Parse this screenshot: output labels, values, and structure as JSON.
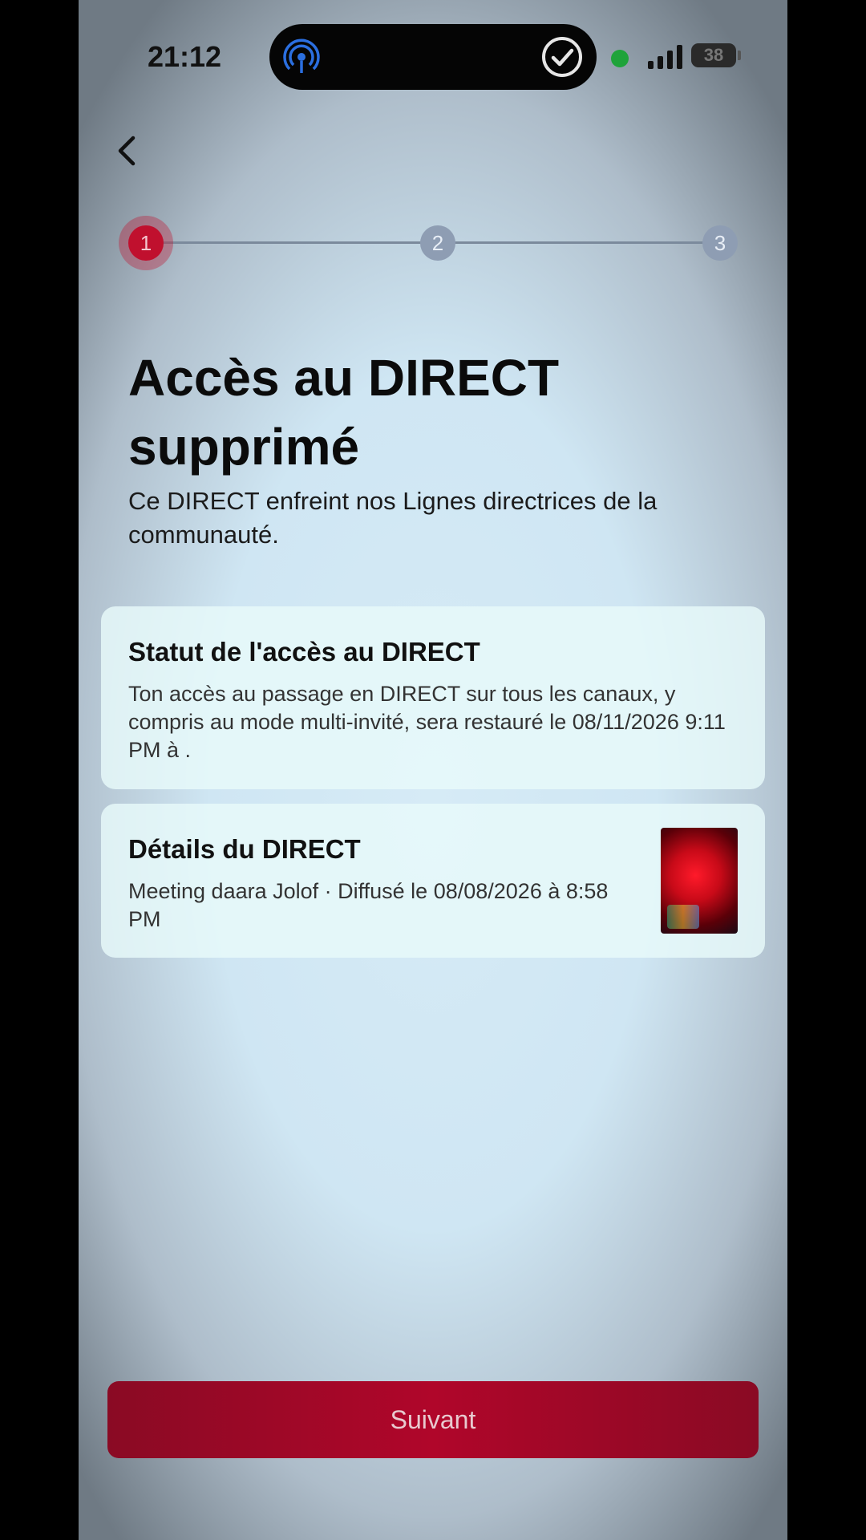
{
  "status_bar": {
    "time": "21:12",
    "battery": "38",
    "icons": [
      "airdrop-icon",
      "check-circle-icon",
      "camera-indicator-dot",
      "signal-icon",
      "battery-icon"
    ]
  },
  "nav": {
    "back_icon": "chevron-left-icon"
  },
  "stepper": {
    "steps": [
      "1",
      "2",
      "3"
    ],
    "active_step": 1,
    "active_color": "#c0102e"
  },
  "header": {
    "title": "Accès au DIRECT supprimé",
    "subtitle": "Ce DIRECT enfreint nos Lignes directrices de la communauté."
  },
  "status_card": {
    "title": "Statut de l'accès au DIRECT",
    "text": "Ton accès au passage en DIRECT sur tous les canaux, y compris au mode multi-invité, sera restauré le 08/11/2026 9:11 PM à ."
  },
  "details_card": {
    "title": "Détails du DIRECT",
    "text": "Meeting daara Jolof · Diffusé le 08/08/2026 à 8:58 PM"
  },
  "footer": {
    "next_label": "Suivant",
    "button_color": "#b0062a"
  }
}
